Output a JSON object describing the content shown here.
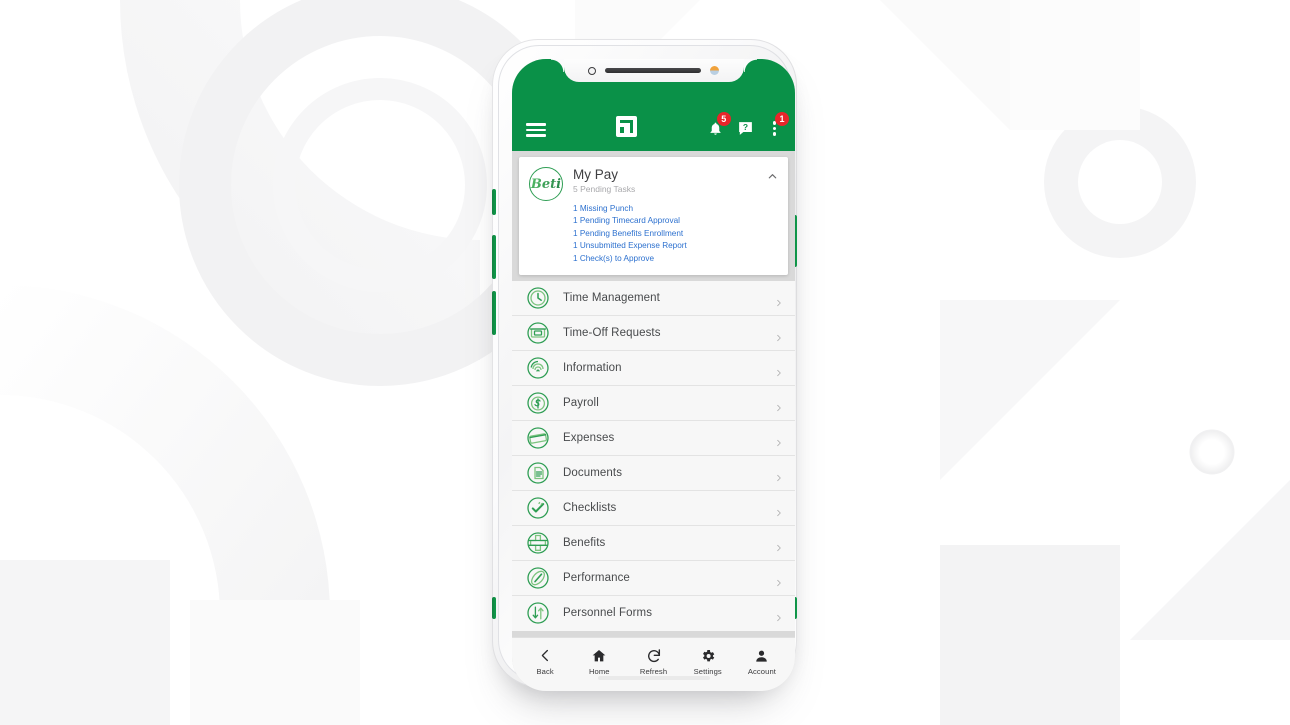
{
  "background": {
    "base_color": "#ffffff",
    "shape_color": "#f4f4f5",
    "description": "subtle white-on-white geometric pattern of circles, arcs, triangles and squares"
  },
  "device": {
    "frame_color": "#f6f6f7",
    "side_button_color": "#0e9c4c",
    "notch": {
      "camera": "camera-icon",
      "speaker": "speaker-grille",
      "sensor": "proximity-sensor"
    }
  },
  "app": {
    "accent_green": "#0a9148",
    "badge_red": "#e8252a",
    "link_blue": "#2d71cf",
    "header": {
      "menu_label": "Menu",
      "logo_label": "Paycom",
      "notifications": {
        "name": "Notifications",
        "badge": "5"
      },
      "help": {
        "name": "Help",
        "glyph": "?"
      },
      "more": {
        "name": "More options",
        "badge": "1"
      }
    },
    "mypay_card": {
      "logo_text": "Beti",
      "title": "My Pay",
      "subtitle": "5 Pending Tasks",
      "collapse_label": "Collapse",
      "tasks": [
        "1 Missing Punch",
        "1 Pending Timecard Approval",
        "1 Pending Benefits Enrollment",
        "1 Unsubmitted Expense Report",
        "1 Check(s) to Approve"
      ]
    },
    "menu_items": [
      {
        "label": "Time Management",
        "icon": "clock-icon"
      },
      {
        "label": "Time-Off Requests",
        "icon": "calendar-money-icon"
      },
      {
        "label": "Information",
        "icon": "fingerprint-icon"
      },
      {
        "label": "Payroll",
        "icon": "dollar-icon"
      },
      {
        "label": "Expenses",
        "icon": "credit-card-icon"
      },
      {
        "label": "Documents",
        "icon": "document-icon"
      },
      {
        "label": "Checklists",
        "icon": "checkmark-icon"
      },
      {
        "label": "Benefits",
        "icon": "medical-cross-icon"
      },
      {
        "label": "Performance",
        "icon": "speedometer-icon"
      },
      {
        "label": "Personnel Forms",
        "icon": "up-down-arrows-icon"
      }
    ],
    "bottom_nav": [
      {
        "label": "Back",
        "icon": "chevron-left-icon"
      },
      {
        "label": "Home",
        "icon": "home-icon"
      },
      {
        "label": "Refresh",
        "icon": "refresh-icon"
      },
      {
        "label": "Settings",
        "icon": "gear-icon"
      },
      {
        "label": "Account",
        "icon": "person-icon"
      }
    ]
  }
}
